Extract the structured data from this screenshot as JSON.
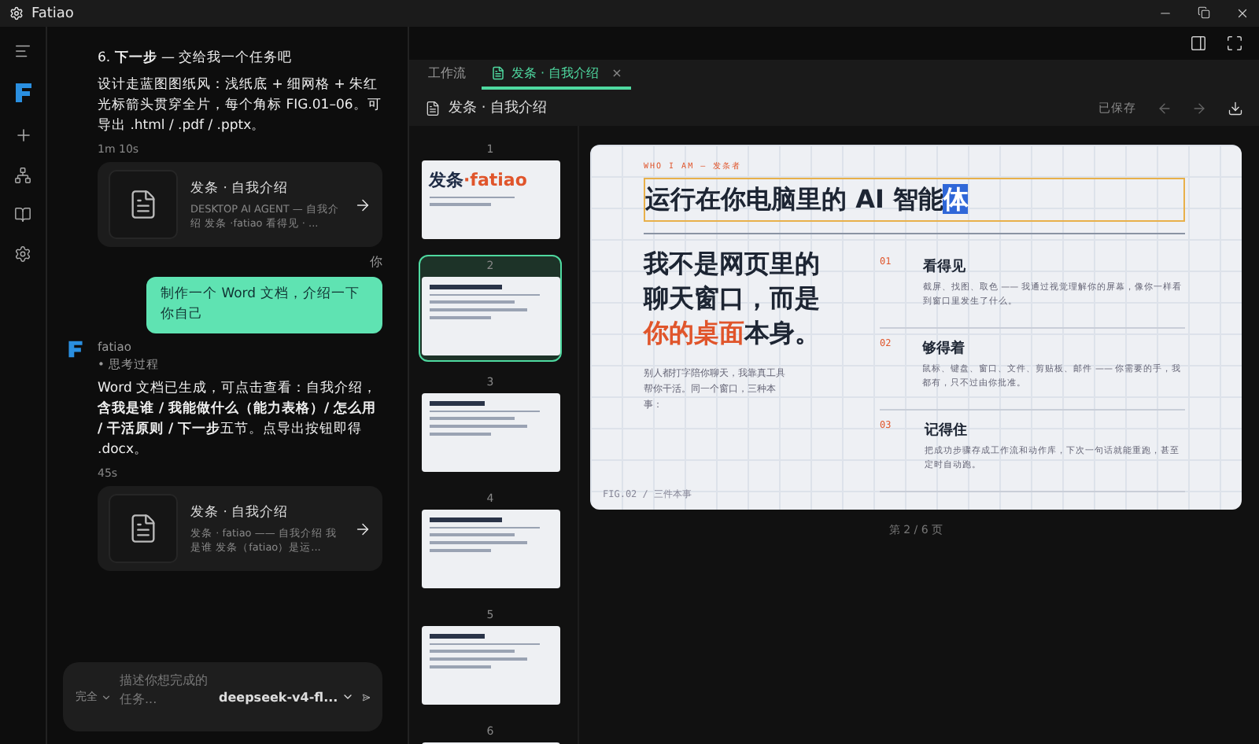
{
  "window": {
    "title": "Fatiao"
  },
  "chat": {
    "messages": [
      {
        "kind": "assistant_tail",
        "heading": "6. **下一步** — 交给我一个任务吧",
        "text": "设计走蓝图图纸风：浅纸底 + 细网格 + 朱红光标箭头贯穿全片，每个角标 FIG.01–06。可导出 .html / .pdf / .pptx。",
        "time": "1m 10s",
        "card": {
          "title": "发条 · 自我介绍",
          "desc": "DESKTOP AI AGENT — 自我介绍 发条 ·fatiao 看得见 · ..."
        }
      },
      {
        "kind": "user",
        "author": "你",
        "text": "制作一个 Word 文档，介绍一下你自己"
      },
      {
        "kind": "assistant",
        "author": "fatiao",
        "bullet": "•",
        "thinking": "思考过程",
        "text": "Word 文档已生成，可点击查看：自我介绍，**含我是谁 / 我能做什么（能力表格）/ 怎么用 / 干活原则 / 下一步**五节。点导出按钮即得 .docx。",
        "time": "45s",
        "card": {
          "title": "发条 · 自我介绍",
          "desc": "发条 · fatiao —— 自我介绍 我是谁 发条（fatiao）是运..."
        }
      }
    ],
    "input": {
      "placeholder": "描述你想完成的任务...",
      "mode": "完全",
      "model": "deepseek-v4-fl..."
    }
  },
  "tabs": [
    {
      "label": "工作流",
      "selected": false
    },
    {
      "label": "发条 · 自我介绍",
      "selected": true,
      "close": "×"
    }
  ],
  "document": {
    "title": "发条 · 自我介绍",
    "status": "已保存"
  },
  "thumbnails": [
    {
      "number": "1",
      "title": "发条",
      "title_accent": "·fatiao",
      "selected": false
    },
    {
      "number": "2",
      "selected": true
    },
    {
      "number": "3",
      "selected": false
    },
    {
      "number": "4",
      "selected": false
    },
    {
      "number": "5",
      "selected": false
    },
    {
      "number": "6",
      "selected": false
    }
  ],
  "slide": {
    "kicker": "WHO I AM — 发条者",
    "title": "运行在你电脑里的 AI 智能",
    "title_selected": "体",
    "statement": [
      {
        "text": "我不是网页里的聊天窗口，而是",
        "accent": false
      },
      {
        "text": "你的桌面",
        "accent": true
      },
      {
        "text": "本身。",
        "accent": false
      }
    ],
    "lead": "别人都打字陪你聊天，我靠真工具帮你干活。同一个窗口，三种本事：",
    "points": [
      {
        "number": "01",
        "title": "看得见",
        "text": "截屏、找图、取色 —— 我通过视觉理解你的屏幕，像你一样看到窗口里发生了什么。"
      },
      {
        "number": "02",
        "title": "够得着",
        "text": "鼠标、键盘、窗口、文件、剪贴板、邮件 —— 你需要的手，我都有，只不过由你批准。"
      },
      {
        "number": "03",
        "title": "记得住",
        "text": "把成功步骤存成工作流和动作库，下次一句话就能重跑，甚至定时自动跑。"
      }
    ],
    "footer": "FIG.02 / 三件本事"
  },
  "pager": "第 2 / 6 页"
}
